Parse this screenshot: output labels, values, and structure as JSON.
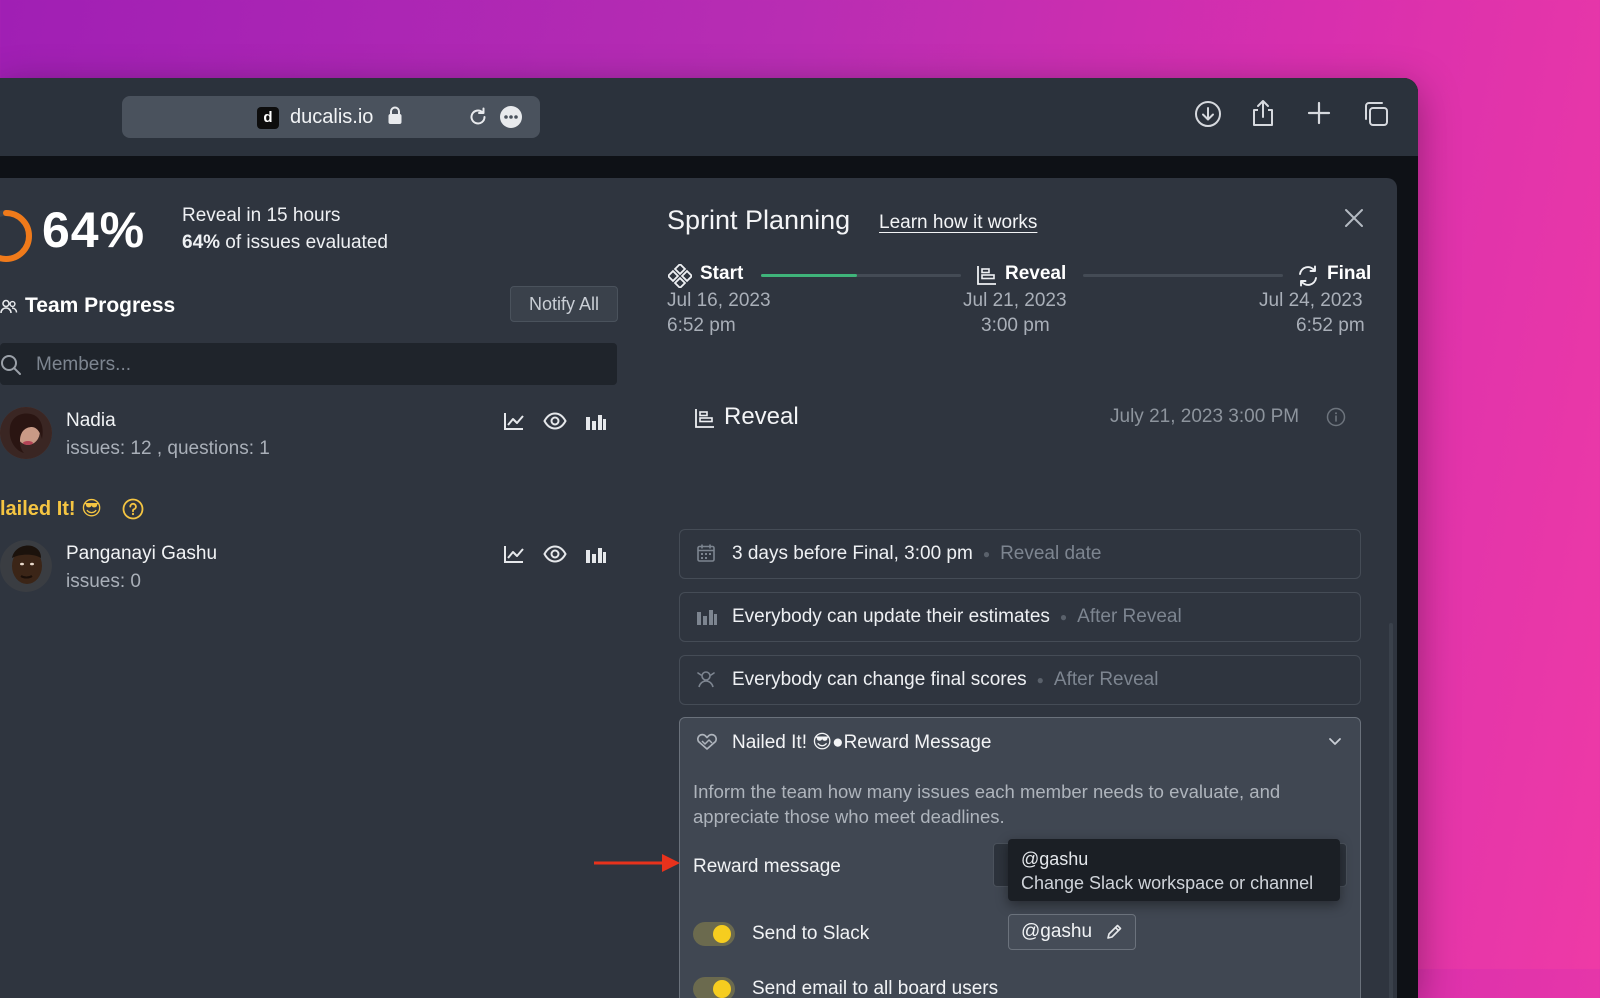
{
  "browser": {
    "favicon_letter": "d",
    "domain": "ducalis.io"
  },
  "progress": {
    "percent_label": "64%",
    "percent_value": 64,
    "reveal_in": "Reveal in 15 hours",
    "issues_pct": "64%",
    "issues_suffix": " of issues evaluated"
  },
  "team": {
    "title": "Team Progress",
    "notify_label": "Notify All",
    "search_placeholder": "Members...",
    "members": [
      {
        "name": "Nadia",
        "meta": "issues: 12 , questions: 1"
      },
      {
        "name": "Panganayi Gashu",
        "meta": "issues: 0"
      }
    ],
    "group_label": "lailed It! 😎"
  },
  "sprint": {
    "title": "Sprint Planning",
    "learn_link": "Learn how it works",
    "timeline": {
      "start": {
        "label": "Start",
        "date": "Jul 16, 2023",
        "time": "6:52 pm"
      },
      "reveal": {
        "label": "Reveal",
        "date": "Jul 21, 2023",
        "time": "3:00 pm"
      },
      "final": {
        "label": "Final",
        "date": "Jul 24, 2023",
        "time": "6:52 pm"
      },
      "progress_fraction": 0.48
    }
  },
  "reveal_section": {
    "title": "Reveal",
    "datetime": "July 21, 2023 3:00 PM",
    "rows": [
      {
        "text": "3 days before Final, 3:00 pm",
        "sub": "Reveal date"
      },
      {
        "text": "Everybody can update their estimates",
        "sub": "After Reveal"
      },
      {
        "text": "Everybody can change final scores",
        "sub": "After Reveal"
      }
    ],
    "reward": {
      "name": "Nailed It! 😎",
      "type": "Reward Message",
      "description": "Inform the team how many issues each member needs to evaluate, and appreciate those who meet deadlines.",
      "message_label": "Reward message",
      "tooltip_title": "@gashu",
      "tooltip_text": "Change Slack workspace or channel",
      "slack_label": "Send to Slack",
      "slack_channel": "@gashu",
      "email_label": "Send email to all board users"
    }
  },
  "colors": {
    "accent_green": "#3fb47a",
    "toggle_on": "#f6cd1f",
    "ring_orange": "#f07a1a",
    "group_yellow": "#f5c542",
    "arrow_red": "#e8321c"
  }
}
